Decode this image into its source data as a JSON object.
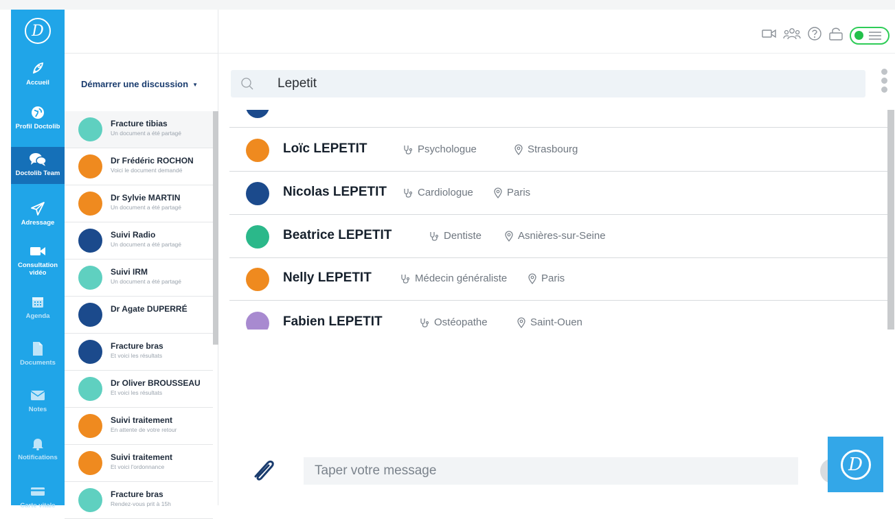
{
  "nav": {
    "logo": "D",
    "items": [
      {
        "label": "Accueil",
        "icon": "rocket-icon"
      },
      {
        "label": "Profil Doctolib",
        "icon": "globe-icon"
      },
      {
        "label": "Doctolib Team",
        "icon": "chat-icon",
        "active": true
      },
      {
        "label": "Adressage",
        "icon": "paper-plane-icon"
      },
      {
        "label": "Consultation vidéo",
        "icon": "video-camera-icon"
      },
      {
        "label": "Agenda",
        "icon": "calendar-icon"
      },
      {
        "label": "Documents",
        "icon": "document-icon"
      },
      {
        "label": "Notes",
        "icon": "envelope-icon"
      },
      {
        "label": "Notifications",
        "icon": "bell-icon"
      },
      {
        "label": "Carte vitale",
        "icon": "card-icon"
      }
    ]
  },
  "conversations": {
    "start_label": "Démarrer une discussion",
    "items": [
      {
        "title": "Fracture tibias",
        "subtitle": "Un document a été partagé",
        "color": "#5fd0c0"
      },
      {
        "title": "Dr Frédéric ROCHON",
        "subtitle": "Voici le document demandé",
        "color": "#ef8a1f"
      },
      {
        "title": "Dr Sylvie MARTIN",
        "subtitle": "Un document a été partagé",
        "color": "#ef8a1f"
      },
      {
        "title": "Suivi Radio",
        "subtitle": "Un document a été partagé",
        "color": "#1b4a8c"
      },
      {
        "title": "Suivi IRM",
        "subtitle": "Un document a été partagé",
        "color": "#5fd0c0"
      },
      {
        "title": "Dr Agate DUPERRÉ",
        "subtitle": "",
        "color": "#1b4a8c"
      },
      {
        "title": "Fracture bras",
        "subtitle": "Et voici les résultats",
        "color": "#1b4a8c"
      },
      {
        "title": "Dr Oliver BROUSSEAU",
        "subtitle": "Et voici les résultats",
        "color": "#5fd0c0"
      },
      {
        "title": "Suivi traitement",
        "subtitle": "En attente de votre retour",
        "color": "#ef8a1f"
      },
      {
        "title": "Suivi traitement",
        "subtitle": "Et voici l'ordonnance",
        "color": "#ef8a1f"
      },
      {
        "title": "Fracture bras",
        "subtitle": "Rendez-vous prit à 15h",
        "color": "#5fd0c0"
      }
    ]
  },
  "search": {
    "value": "Lepetit"
  },
  "results": [
    {
      "name": "Loïc LEPETIT",
      "specialty": "Psychologue",
      "city": "Strasbourg",
      "color": "#ef8a1f"
    },
    {
      "name": "Nicolas LEPETIT",
      "specialty": "Cardiologue",
      "city": "Paris",
      "color": "#1b4a8c"
    },
    {
      "name": "Beatrice LEPETIT",
      "specialty": "Dentiste",
      "city": "Asnières-sur-Seine",
      "color": "#2bb88a"
    },
    {
      "name": "Nelly LEPETIT",
      "specialty": "Médecin généraliste",
      "city": "Paris",
      "color": "#ef8a1f"
    },
    {
      "name": "Fabien LEPETIT",
      "specialty": "Ostéopathe",
      "city": "Saint-Ouen",
      "color": "#a88ad0"
    }
  ],
  "composer": {
    "placeholder": "Taper votre message"
  },
  "toolbar": {
    "status_color": "#22c04a"
  }
}
